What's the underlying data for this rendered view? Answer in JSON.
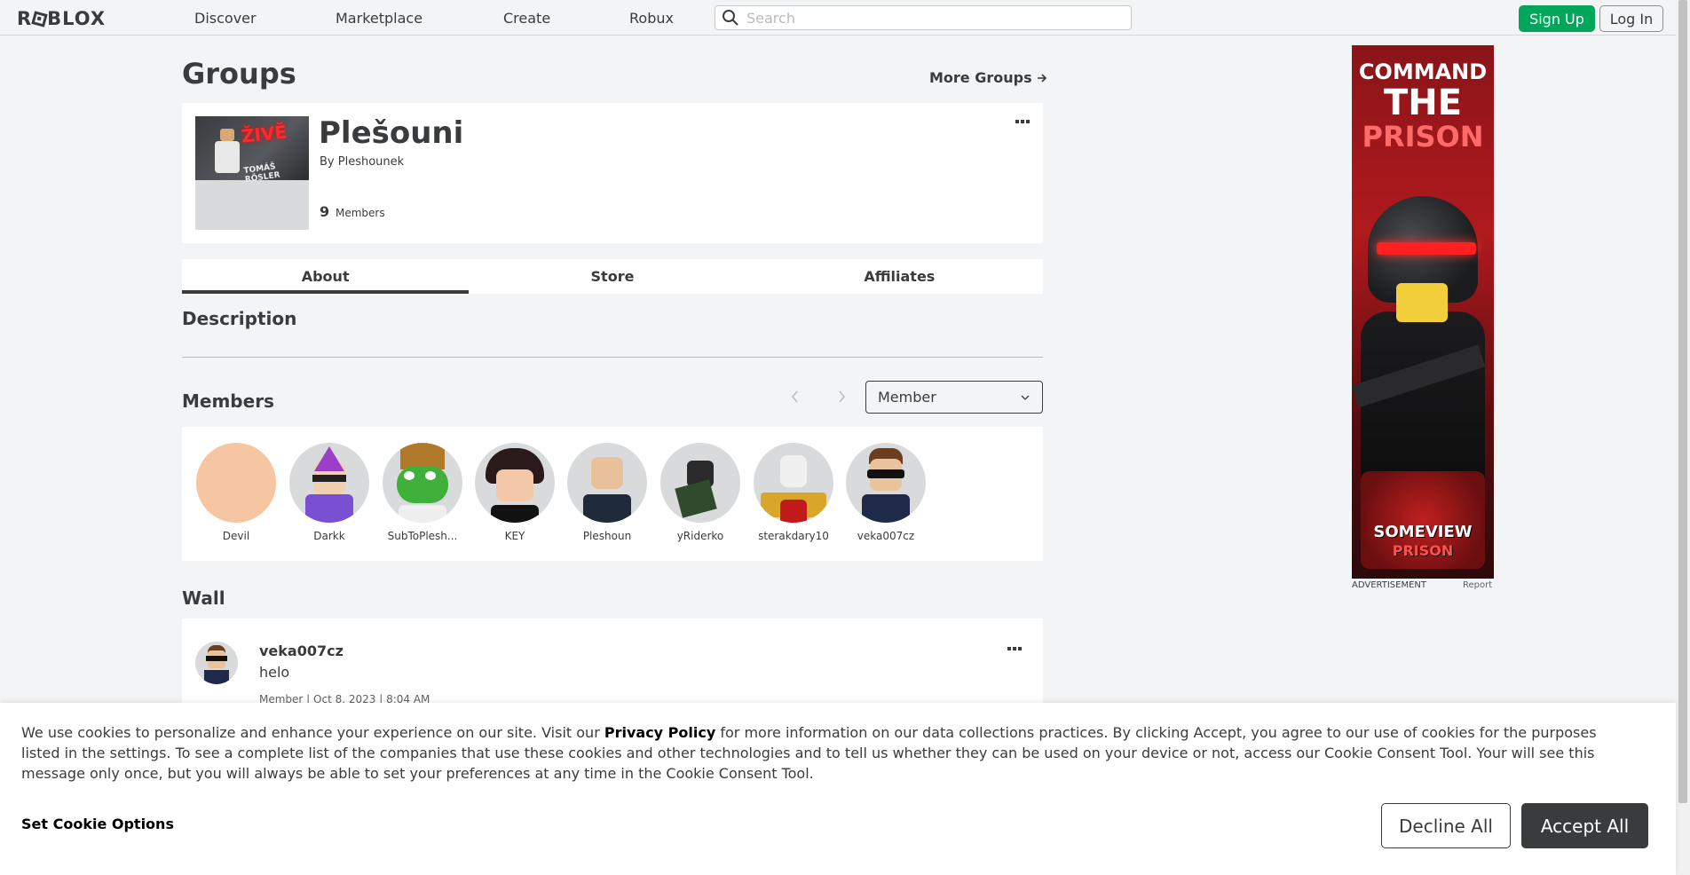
{
  "nav": {
    "logo": "ROBLOX",
    "links": [
      "Discover",
      "Marketplace",
      "Create",
      "Robux"
    ],
    "search_placeholder": "Search",
    "signup_label": "Sign Up",
    "login_label": "Log In",
    "accent_green": "#00a65a"
  },
  "page": {
    "title": "Groups",
    "more_groups": "More Groups"
  },
  "group": {
    "emblem_word": "ŽIVĚ",
    "emblem_name": "TOMÁŠ RÖSLER",
    "name": "Plešouni",
    "by_label": "By",
    "owner": "Pleshounek",
    "member_count": "9",
    "members_label": "Members"
  },
  "tabs": [
    "About",
    "Store",
    "Affiliates"
  ],
  "about": {
    "description_title": "Description",
    "members_title": "Members",
    "role_selected": "Member",
    "members": [
      {
        "name": "Devil",
        "icon": "avatar-devil"
      },
      {
        "name": "Darkk",
        "icon": "avatar-darkk"
      },
      {
        "name": "SubToPlesh...",
        "icon": "avatar-subtoplesh"
      },
      {
        "name": "KEY",
        "icon": "avatar-key"
      },
      {
        "name": "Pleshoun",
        "icon": "avatar-pleshoun"
      },
      {
        "name": "yRiderko",
        "icon": "avatar-yriderko"
      },
      {
        "name": "sterakdary10",
        "icon": "avatar-sterakdary10"
      },
      {
        "name": "veka007cz",
        "icon": "avatar-veka007cz"
      }
    ],
    "wall_title": "Wall",
    "wall_post": {
      "user": "veka007cz",
      "text": "helo",
      "meta": "Member | Oct 8, 2023 | 8:04 AM"
    }
  },
  "ad": {
    "line1": "COMMAND",
    "line2": "THE",
    "line3": "PRISON",
    "badge_line1": "SOMEVIEW",
    "badge_line2": "PRISON",
    "label": "ADVERTISEMENT",
    "report": "Report"
  },
  "cookie": {
    "text_before": "We use cookies to personalize and enhance your experience on our site. Visit our ",
    "privacy_link": "Privacy Policy",
    "text_after": " for more information on our data collections practices. By clicking Accept, you agree to our use of cookies for the purposes listed in the settings. To see a complete list of the companies that use these cookies and other technologies and to tell us whether they can be used on your device or not, access our Cookie Consent Tool. Your will see this message only once, but you will always be able to set your preferences at any time in the Cookie Consent Tool.",
    "options_label": "Set Cookie Options",
    "decline_label": "Decline All",
    "accept_label": "Accept All"
  }
}
